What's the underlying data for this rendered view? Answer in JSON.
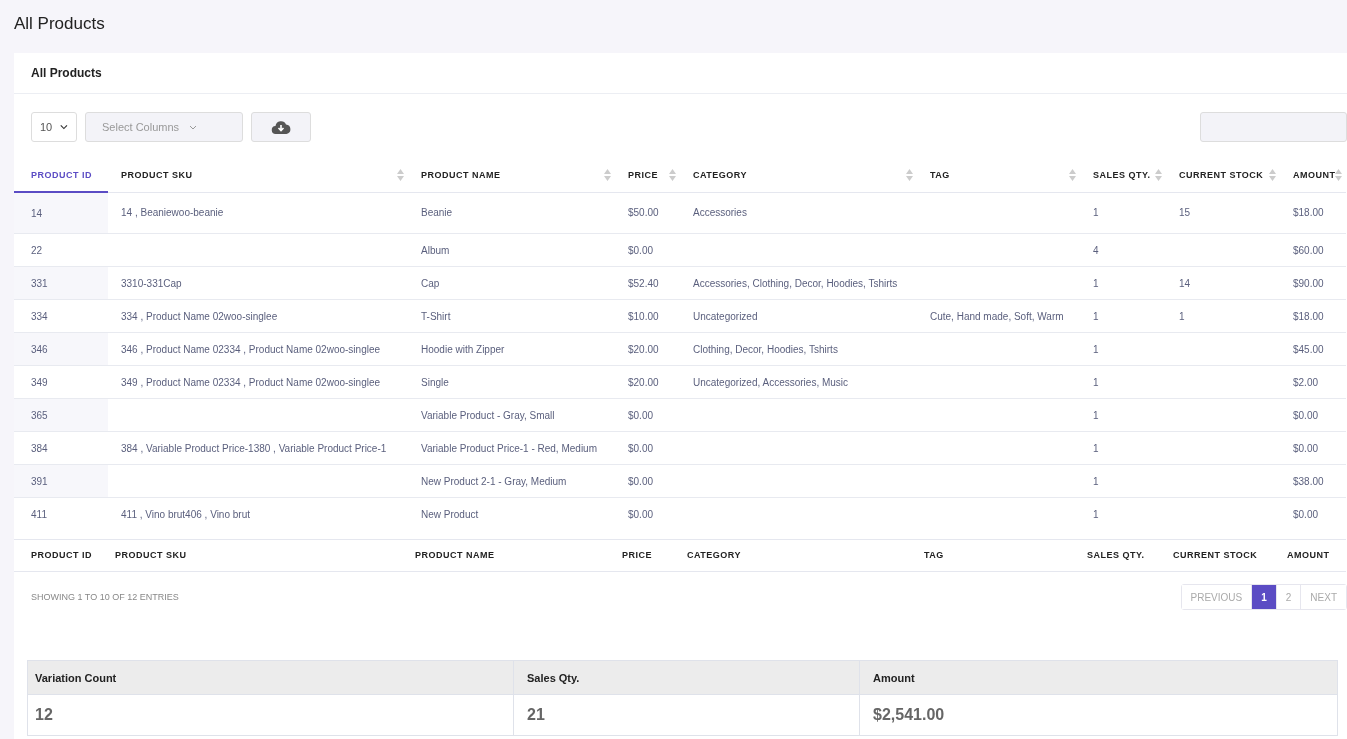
{
  "page_title": "All Products",
  "card": {
    "title": "All Products"
  },
  "toolbar": {
    "page_size": "10",
    "columns_select": {
      "placeholder": "Select Columns"
    }
  },
  "table": {
    "columns": [
      {
        "label": "PRODUCT ID",
        "selected": true
      },
      {
        "label": "PRODUCT SKU",
        "selected": false
      },
      {
        "label": "PRODUCT NAME",
        "selected": false
      },
      {
        "label": "PRICE",
        "selected": false
      },
      {
        "label": "CATEGORY",
        "selected": false
      },
      {
        "label": "TAG",
        "selected": false
      },
      {
        "label": "SALES QTY.",
        "selected": false
      },
      {
        "label": "CURRENT STOCK",
        "selected": false
      },
      {
        "label": "AMOUNT",
        "selected": false
      }
    ],
    "rows": [
      [
        "14",
        "14 , Beaniewoo-beanie",
        "Beanie",
        "$50.00",
        "Accessories",
        "",
        "1",
        "15",
        "$18.00"
      ],
      [
        "22",
        "",
        "Album",
        "$0.00",
        "",
        "",
        "4",
        "",
        "$60.00"
      ],
      [
        "331",
        "3310-331Cap",
        "Cap",
        "$52.40",
        "Accessories, Clothing, Decor, Hoodies, Tshirts",
        "",
        "1",
        "14",
        "$90.00"
      ],
      [
        "334",
        "334 , Product Name 02woo-singlee",
        "T-Shirt",
        "$10.00",
        "Uncategorized",
        "Cute, Hand made, Soft, Warm",
        "1",
        "1",
        "$18.00"
      ],
      [
        "346",
        "346 , Product Name 02334 , Product Name 02woo-singlee",
        "Hoodie with Zipper",
        "$20.00",
        "Clothing, Decor, Hoodies, Tshirts",
        "",
        "1",
        "",
        "$45.00"
      ],
      [
        "349",
        "349 , Product Name 02334 , Product Name 02woo-singlee",
        "Single",
        "$20.00",
        "Uncategorized, Accessories, Music",
        "",
        "1",
        "",
        "$2.00"
      ],
      [
        "365",
        "",
        "Variable Product - Gray, Small",
        "$0.00",
        "",
        "",
        "1",
        "",
        "$0.00"
      ],
      [
        "384",
        "384 , Variable Product Price-1380 , Variable Product Price-1",
        "Variable Product Price-1 - Red, Medium",
        "$0.00",
        "",
        "",
        "1",
        "",
        "$0.00"
      ],
      [
        "391",
        "",
        "New Product 2-1 - Gray, Medium",
        "$0.00",
        "",
        "",
        "1",
        "",
        "$38.00"
      ],
      [
        "411",
        "411 , Vino brut406 , Vino brut",
        "New Product",
        "$0.00",
        "",
        "",
        "1",
        "",
        "$0.00"
      ]
    ],
    "footer": [
      "PRODUCT ID",
      "PRODUCT SKU",
      "PRODUCT NAME",
      "PRICE",
      "CATEGORY",
      "TAG",
      "SALES QTY.",
      "CURRENT STOCK",
      "AMOUNT"
    ]
  },
  "info": "SHOWING 1 TO 10 OF 12 ENTRIES",
  "pagination": [
    {
      "label": "PREVIOUS",
      "selected": false
    },
    {
      "label": "1",
      "selected": true
    },
    {
      "label": "2",
      "selected": false
    },
    {
      "label": "NEXT",
      "selected": false
    }
  ],
  "summary": {
    "columns": [
      "Variation Count",
      "Sales Qty.",
      "Amount"
    ],
    "values": [
      "12",
      "21",
      "$2,541.00"
    ]
  }
}
